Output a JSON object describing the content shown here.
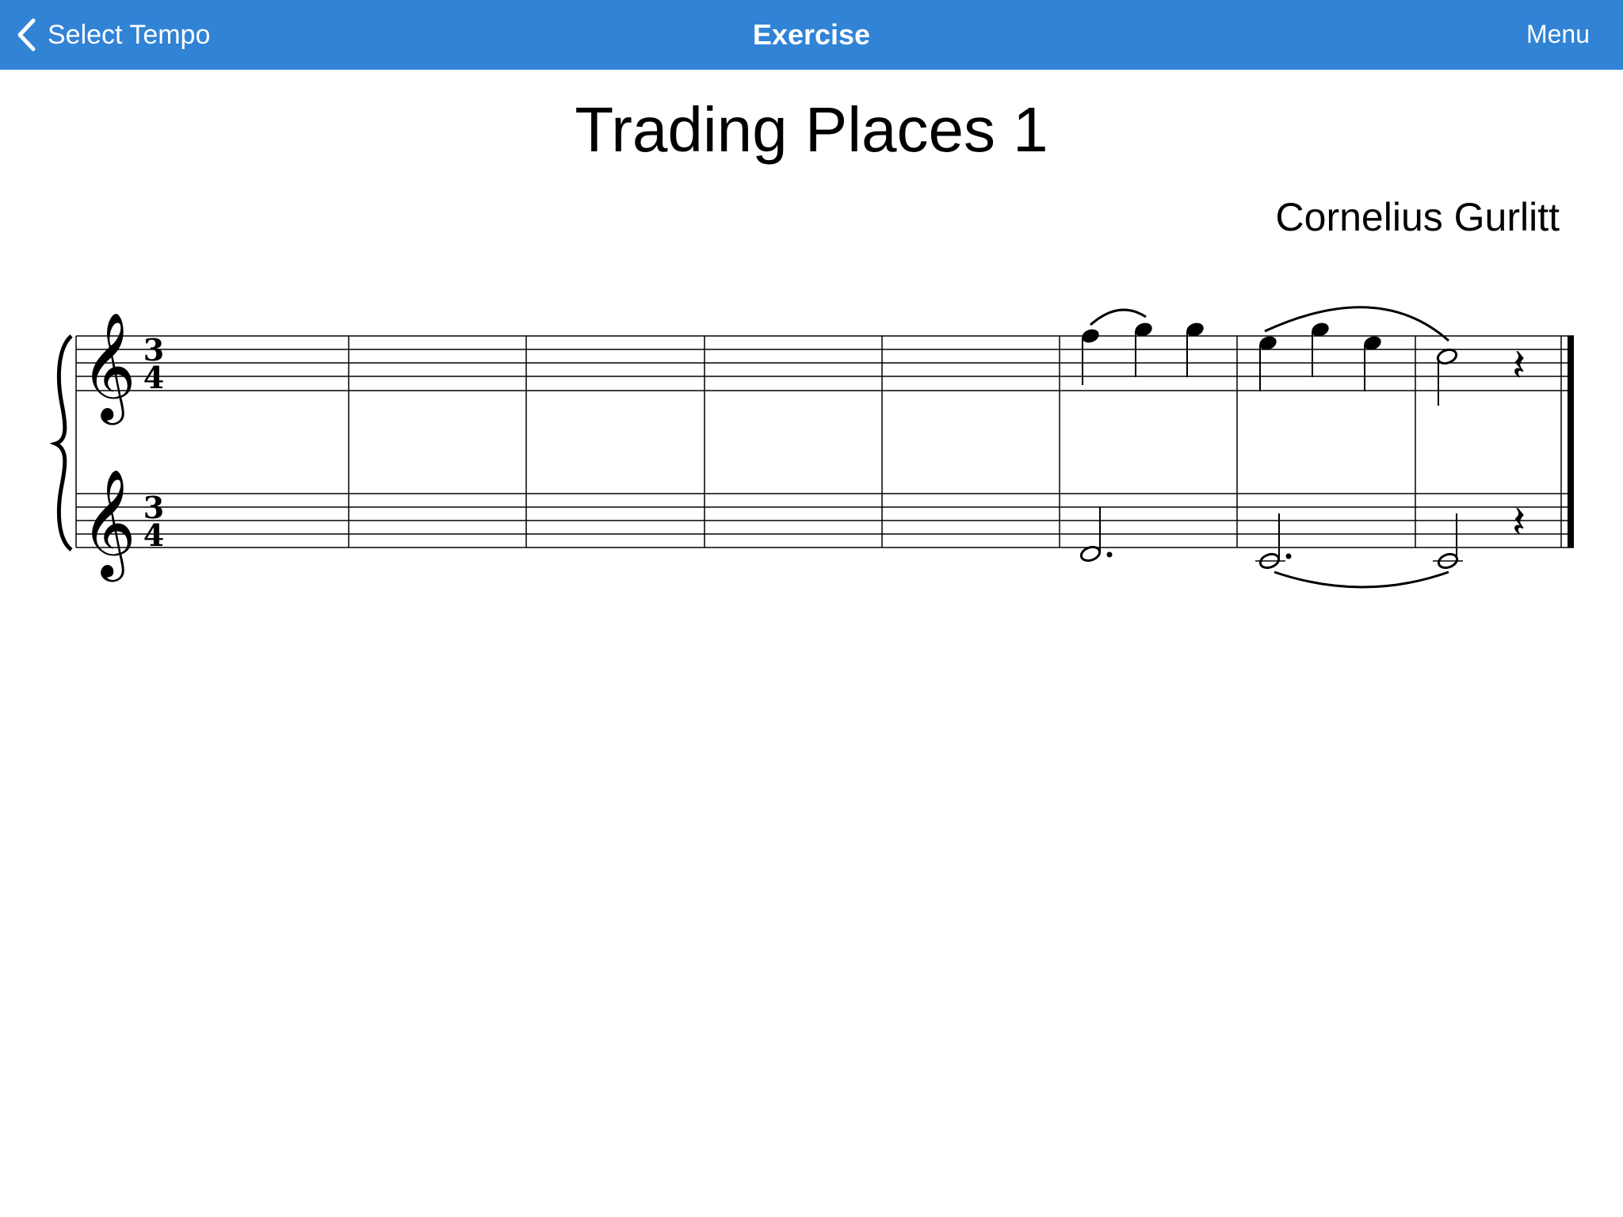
{
  "nav": {
    "back_label": "Select Tempo",
    "title": "Exercise",
    "menu_label": "Menu",
    "bar_color": "#3183d6",
    "back_icon": "chevron-left-icon"
  },
  "score": {
    "title": "Trading Places 1",
    "composer": "Cornelius Gurlitt",
    "time_signature": {
      "beats": "3",
      "beat_unit": "4"
    },
    "clefs": [
      "treble",
      "treble"
    ],
    "measure_count": 8,
    "measures": [
      {
        "number": 1,
        "upper": [],
        "lower": []
      },
      {
        "number": 2,
        "upper": [],
        "lower": []
      },
      {
        "number": 3,
        "upper": [],
        "lower": []
      },
      {
        "number": 4,
        "upper": [],
        "lower": []
      },
      {
        "number": 5,
        "upper": [],
        "lower": []
      },
      {
        "number": 6,
        "upper": [
          "F5 quarter",
          "G5 quarter",
          "G5 quarter"
        ],
        "lower": [
          "D4 dotted-half"
        ]
      },
      {
        "number": 7,
        "upper": [
          "E5 quarter",
          "G5 quarter",
          "E5 quarter"
        ],
        "lower": [
          "C4 dotted-half"
        ]
      },
      {
        "number": 8,
        "upper": [
          "C5 half",
          "quarter rest"
        ],
        "lower": [
          "C4 half",
          "quarter rest"
        ]
      }
    ]
  }
}
